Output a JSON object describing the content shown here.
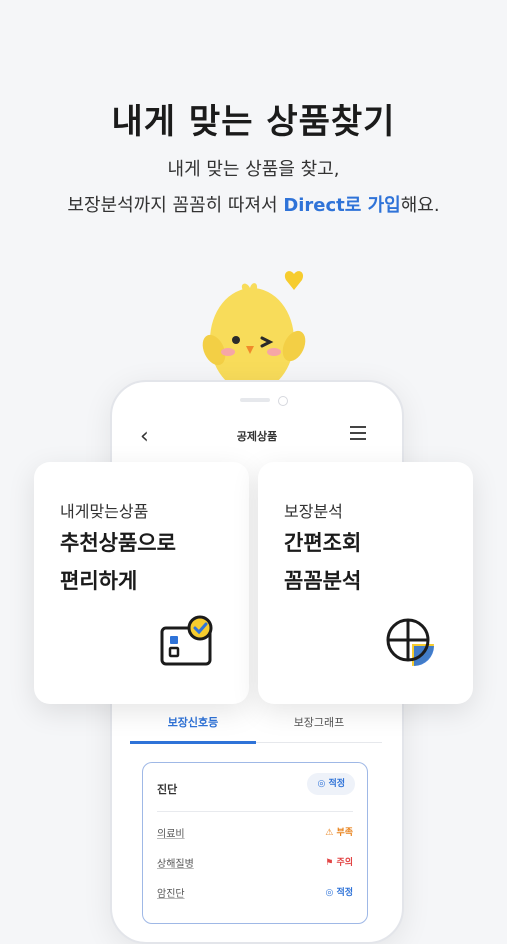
{
  "title": "내게 맞는 상품찾기",
  "subtitle": {
    "line1": "내게 맞는 상품을 찾고,",
    "line2_prefix": "보장분석까지 꼼꼼히 따져서 ",
    "line2_highlight": "Direct로 가입",
    "line2_suffix": "해요."
  },
  "phone": {
    "nav_title": "공제상품",
    "tabs": [
      "보장신호등",
      "보장그래프"
    ],
    "panel": {
      "header": "진단",
      "badge": "적정",
      "rows": [
        {
          "label": "의료비",
          "status": "부족",
          "level": "warn"
        },
        {
          "label": "상해질병",
          "status": "주의",
          "level": "danger"
        },
        {
          "label": "암진단",
          "status": "적정",
          "level": "ok"
        }
      ]
    }
  },
  "cards": {
    "left": {
      "sub": "내게맞는상품",
      "main1": "추천상품으로",
      "main2": "편리하게",
      "icon": "id-card-check-icon"
    },
    "right": {
      "sub": "보장분석",
      "main1": "간편조회",
      "main2": "꼼꼼분석",
      "icon": "pie-analysis-icon"
    }
  },
  "colors": {
    "accent": "#2f73d8",
    "warn": "#e8811a",
    "danger": "#e24545",
    "mascot": "#f8dc5a"
  }
}
